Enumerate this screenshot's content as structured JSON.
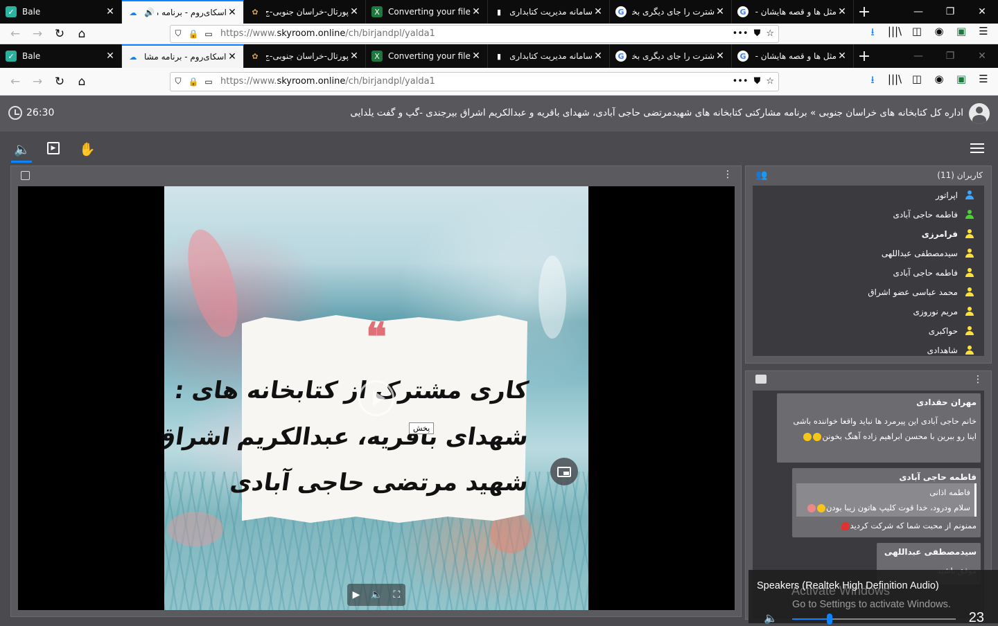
{
  "browser": {
    "tabs": [
      {
        "title": "Bale",
        "favicon": "bale-icon",
        "active": false
      },
      {
        "title": "اسکای‌روم - برنامه مشا",
        "favicon": "skyroom-icon",
        "active": true
      },
      {
        "title": "پورتال-خراسان جنوبی-ج",
        "favicon": "portal-icon",
        "active": false
      },
      {
        "title": "Converting your file",
        "favicon": "excel-icon",
        "active": false
      },
      {
        "title": "سامانه مدیریت کتابداری",
        "favicon": "book-icon",
        "active": false
      },
      {
        "title": "شترت را جای دیگری بخو",
        "favicon": "google-icon",
        "active": false
      },
      {
        "title": "مثل ها و قصه هایشان - ب",
        "favicon": "google-icon",
        "active": false
      }
    ],
    "url_prefix": "https://www.",
    "url_domain": "skyroom.online",
    "url_path": "/ch/birjandpl/yalda1"
  },
  "room": {
    "timer": "26:30",
    "title": "اداره کل کتابخانه های خراسان جنوبی » برنامه مشارکتی کتابخانه های شهیدمرتضی حاجی آبادی، شهدای باقریه و عبدالکریم اشراق بیرجندی -گپ و گفت یلدایی"
  },
  "video": {
    "quote": "❝",
    "lines": [
      "کاری مشترک از کتابخانه های :",
      "شهدای باقریه، عبدالکریم اشراق",
      "شهید مرتضی حاجی آبادی"
    ],
    "tooltip": "پخش"
  },
  "users": {
    "header": "کاربران (11)",
    "list": [
      {
        "name": "اپراتور",
        "color": "#3da5ff",
        "bold": false
      },
      {
        "name": "فاطمه حاجی آبادی",
        "color": "#4cd137",
        "bold": false
      },
      {
        "name": "فرامرزی",
        "color": "#ffe13a",
        "bold": true
      },
      {
        "name": "سیدمصطفی عبداللهی",
        "color": "#ffe13a",
        "bold": false
      },
      {
        "name": "فاطمه حاجی آبادی",
        "color": "#ffe13a",
        "bold": false
      },
      {
        "name": "محمد عباسی عضو اشراق",
        "color": "#ffe13a",
        "bold": false
      },
      {
        "name": "مریم نوروزی",
        "color": "#ffe13a",
        "bold": false
      },
      {
        "name": "حواکبری",
        "color": "#ffe13a",
        "bold": false
      },
      {
        "name": "شاهدادی",
        "color": "#ffe13a",
        "bold": false
      }
    ]
  },
  "chat": {
    "messages": [
      {
        "sender": "مهران حقدادی",
        "lines": [
          "خانم حاجی آبادی این پیرمرد ها نباید واقعا خواننده باشی",
          "اینا رو ببرین با محسن ابراهیم زاده آهنگ بخونن"
        ]
      },
      {
        "sender": "فاطمه حاجی آبادی",
        "reply_name": "فاطمه اذانی",
        "reply_text": "سلام ودرود، خدا قوت کلیپ هاتون زیبا بودن",
        "text": "ممنونم از محبت شما که شرکت کردید"
      },
      {
        "sender": "سیدمصطفی عبداللهی",
        "text": "موفق باشید"
      }
    ]
  },
  "toast": {
    "device": "Speakers (Realtek High Definition Audio)",
    "watermark_title": "Activate Windows",
    "watermark_sub": "Go to Settings to activate Windows.",
    "volume": "23",
    "volume_level": 0.23
  }
}
